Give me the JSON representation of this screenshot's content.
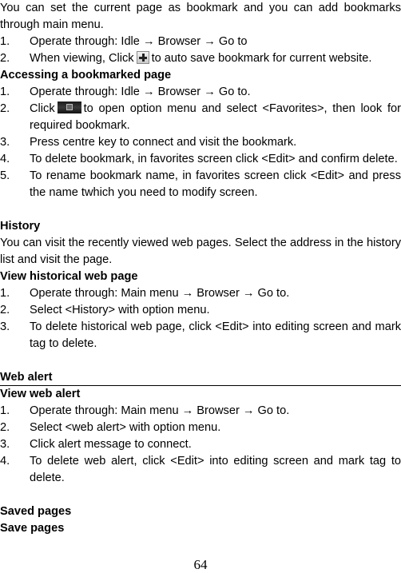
{
  "intro": "You can set the current page as bookmark and you can add bookmarks through main menu.",
  "intro_steps": [
    {
      "num": "1.",
      "text": "Operate through: Idle → Browser → Go to"
    },
    {
      "num": "2.",
      "before": "When viewing, Click",
      "icon": "plus-icon",
      "after": "to auto save bookmark for current website."
    }
  ],
  "accessing": {
    "heading": "Accessing a bookmarked page",
    "steps": [
      {
        "num": "1.",
        "text": "Operate through: Idle → Browser → Go to."
      },
      {
        "num": "2.",
        "before": "Click",
        "icon": "menu-key-icon",
        "after": "to open option menu and select <Favorites>, then look for required bookmark."
      },
      {
        "num": "3.",
        "text": "Press centre key to connect and visit the bookmark."
      },
      {
        "num": "4.",
        "text": "To delete bookmark, in favorites screen click <Edit> and confirm delete."
      },
      {
        "num": "5.",
        "text": "To rename bookmark name, in favorites screen click <Edit> and press the name twhich you need to modify screen."
      }
    ]
  },
  "history": {
    "heading": "History",
    "body": "You can visit the recently viewed web pages. Select the address in the history list and visit the page.",
    "subheading": "View historical web page",
    "steps": [
      {
        "num": "1.",
        "text": "Operate through: Main menu → Browser → Go to."
      },
      {
        "num": "2.",
        "text": "Select <History> with option menu."
      },
      {
        "num": "3.",
        "text": "To delete historical web page, click <Edit> into editing screen and mark tag to delete."
      }
    ]
  },
  "web_alert": {
    "heading": "Web alert",
    "subheading": "View web alert",
    "steps": [
      {
        "num": "1.",
        "text": "Operate through: Main menu → Browser → Go to."
      },
      {
        "num": "2.",
        "text": "Select <web alert> with option menu."
      },
      {
        "num": "3.",
        "text": "Click alert message to connect."
      },
      {
        "num": "4.",
        "text": "To delete web alert, click <Edit> into editing screen and mark tag to delete."
      }
    ]
  },
  "saved_pages": {
    "heading": "Saved pages",
    "subheading": "Save pages"
  },
  "page_number": "64"
}
